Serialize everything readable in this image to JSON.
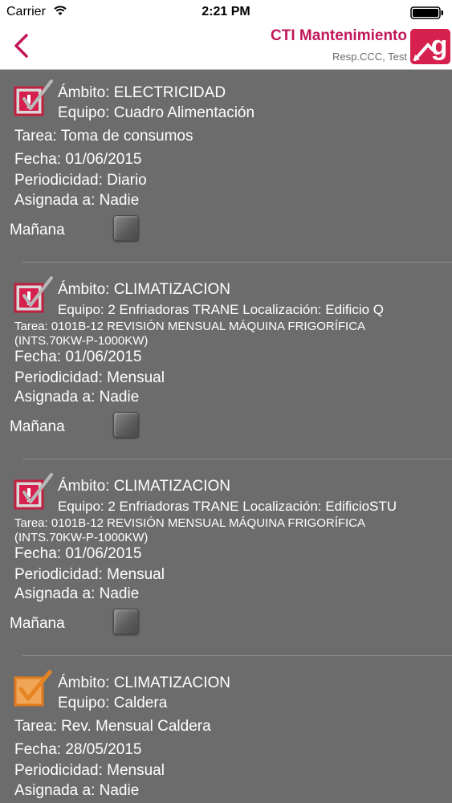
{
  "status_bar": {
    "carrier": "Carrier",
    "time": "2:21 PM"
  },
  "header": {
    "title": "CTI Mantenimiento",
    "subtitle": "Resp.CCC, Test",
    "accent_color": "#c2185b",
    "logo_letter": "g"
  },
  "labels": {
    "tomorrow": "Mañana"
  },
  "tasks": [
    {
      "ambito": "Ámbito: ELECTRICIDAD",
      "equipo": "Equipo: Cuadro Alimentación",
      "tarea_line1": "Tarea: Toma de consumos",
      "tarea_line2": "",
      "fecha": "Fecha: 01/06/2015",
      "periodicidad": "Periodicidad: Diario",
      "asignada": "Asignada a: Nadie",
      "status_icon": "warning-check-icon"
    },
    {
      "ambito": "Ámbito: CLIMATIZACION",
      "equipo": "Equipo: 2 Enfriadoras TRANE Localización: Edificio Q",
      "tarea_line1": "Tarea: 0101B-12 REVISIÓN MENSUAL MÁQUINA FRIGORÍFICA",
      "tarea_line2": "(INTS.70KW-P-1000KW)",
      "fecha": "Fecha: 01/06/2015",
      "periodicidad": "Periodicidad: Mensual",
      "asignada": "Asignada a: Nadie",
      "status_icon": "warning-check-icon"
    },
    {
      "ambito": "Ámbito: CLIMATIZACION",
      "equipo": "Equipo: 2 Enfriadoras TRANE Localización: EdificioSTU",
      "tarea_line1": "Tarea: 0101B-12 REVISIÓN MENSUAL MÁQUINA FRIGORÍFICA",
      "tarea_line2": "(INTS.70KW-P-1000KW)",
      "fecha": "Fecha: 01/06/2015",
      "periodicidad": "Periodicidad: Mensual",
      "asignada": "Asignada a: Nadie",
      "status_icon": "warning-check-icon"
    },
    {
      "ambito": "Ámbito: CLIMATIZACION",
      "equipo": "Equipo: Caldera",
      "tarea_line1": "Tarea: Rev. Mensual Caldera",
      "tarea_line2": "",
      "fecha": "Fecha: 28/05/2015",
      "periodicidad": "Periodicidad: Mensual",
      "asignada": "Asignada a: Nadie",
      "status_icon": "orange-check-icon"
    }
  ]
}
